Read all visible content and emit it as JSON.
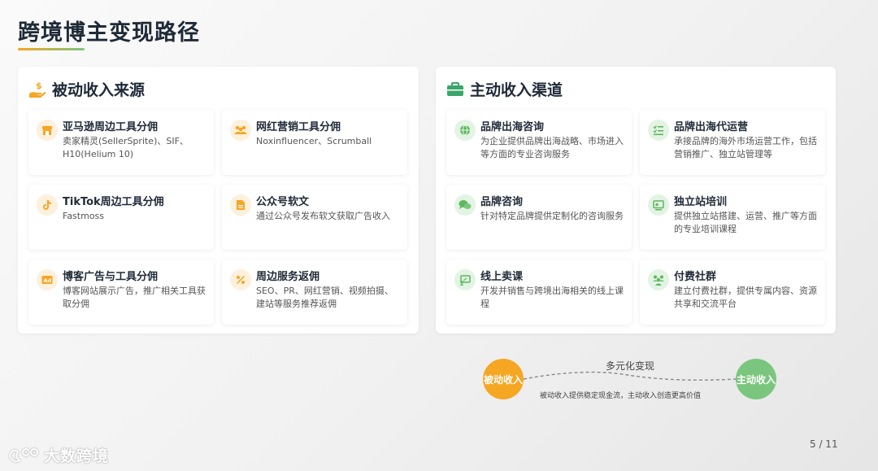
{
  "title": "跨境博主变现路径",
  "passive": {
    "header": "被动收入来源",
    "icon": "hand-money-icon",
    "cards": [
      {
        "title": "亚马逊周边工具分佣",
        "desc": "卖家精灵(SellerSprite)、SIF、H10(Helium 10)",
        "icon": "store-icon"
      },
      {
        "title": "网红营销工具分佣",
        "desc": "Noxinfluencer、Scrumball",
        "icon": "users-icon"
      },
      {
        "title": "TikTok周边工具分佣",
        "desc": "Fastmoss",
        "icon": "tiktok-icon"
      },
      {
        "title": "公众号软文",
        "desc": "通过公众号发布软文获取广告收入",
        "icon": "document-icon"
      },
      {
        "title": "博客广告与工具分佣",
        "desc": "博客网站展示广告，推广相关工具获取分佣",
        "icon": "ad-icon"
      },
      {
        "title": "周边服务返佣",
        "desc": "SEO、PR、网红营销、视频拍摄、建站等服务推荐返佣",
        "icon": "percent-icon"
      }
    ]
  },
  "active": {
    "header": "主动收入渠道",
    "icon": "briefcase-icon",
    "cards": [
      {
        "title": "品牌出海咨询",
        "desc": "为企业提供品牌出海战略、市场进入等方面的专业咨询服务",
        "icon": "globe-icon"
      },
      {
        "title": "品牌出海代运营",
        "desc": "承接品牌的海外市场运营工作，包括营销推广、独立站管理等",
        "icon": "task-list-icon"
      },
      {
        "title": "品牌咨询",
        "desc": "针对特定品牌提供定制化的咨询服务",
        "icon": "chat-icon"
      },
      {
        "title": "独立站培训",
        "desc": "提供独立站搭建、运营、推广等方面的专业培训课程",
        "icon": "screen-icon"
      },
      {
        "title": "线上卖课",
        "desc": "开发并销售与跨境出海相关的线上课程",
        "icon": "presentation-icon"
      },
      {
        "title": "付费社群",
        "desc": "建立付费社群，提供专属内容、资源共享和交流平台",
        "icon": "group-icon"
      }
    ]
  },
  "flow": {
    "left": "被动收入",
    "right": "主动收入",
    "label": "多元化变现",
    "sub": "被动收入提供稳定现金流，主动收入创造更高价值"
  },
  "page_number": "5 / 11",
  "logo_text": "大数跨境",
  "colors": {
    "orange": "#f5a623",
    "green": "#7bc67e",
    "title": "#1f2a37"
  }
}
